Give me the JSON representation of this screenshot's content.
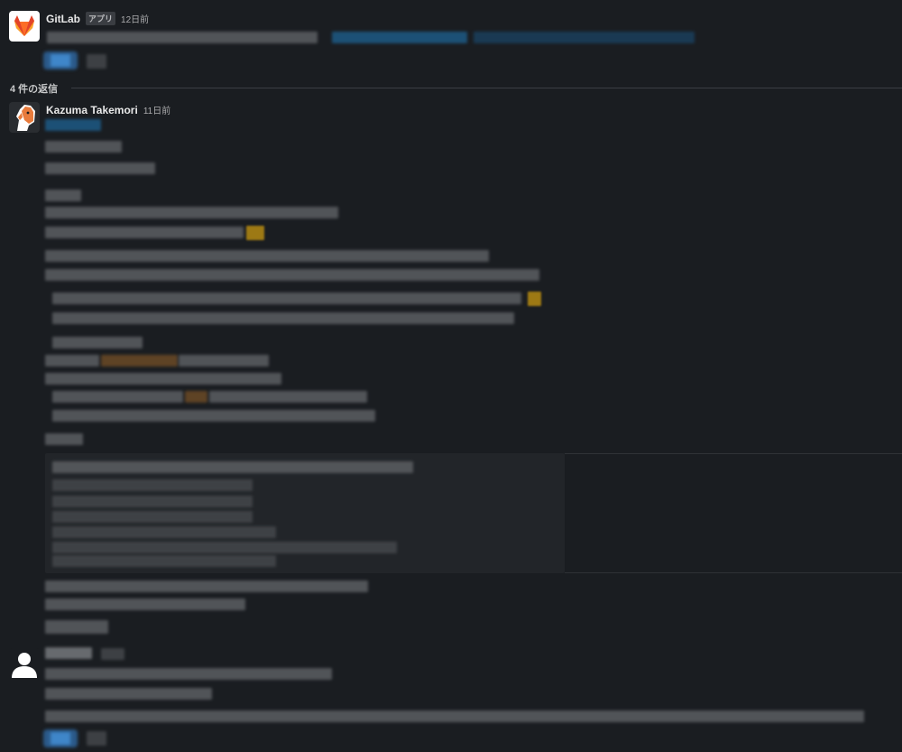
{
  "gitlab_message": {
    "author": "GitLab",
    "badge": "アプリ",
    "time": "12日前"
  },
  "thread": {
    "reply_count_label": "4 件の返信"
  },
  "reply_1": {
    "author": "Kazuma Takemori",
    "time": "11日前"
  },
  "colors": {
    "background": "#1a1d21",
    "gitlab_orange": "#fc6d26",
    "link_blue": "#1d9bd1"
  },
  "icons": {
    "gitlab_avatar": "gitlab-logo-icon",
    "user_avatar": "horse-avatar-icon",
    "default_avatar": "default-person-icon"
  }
}
